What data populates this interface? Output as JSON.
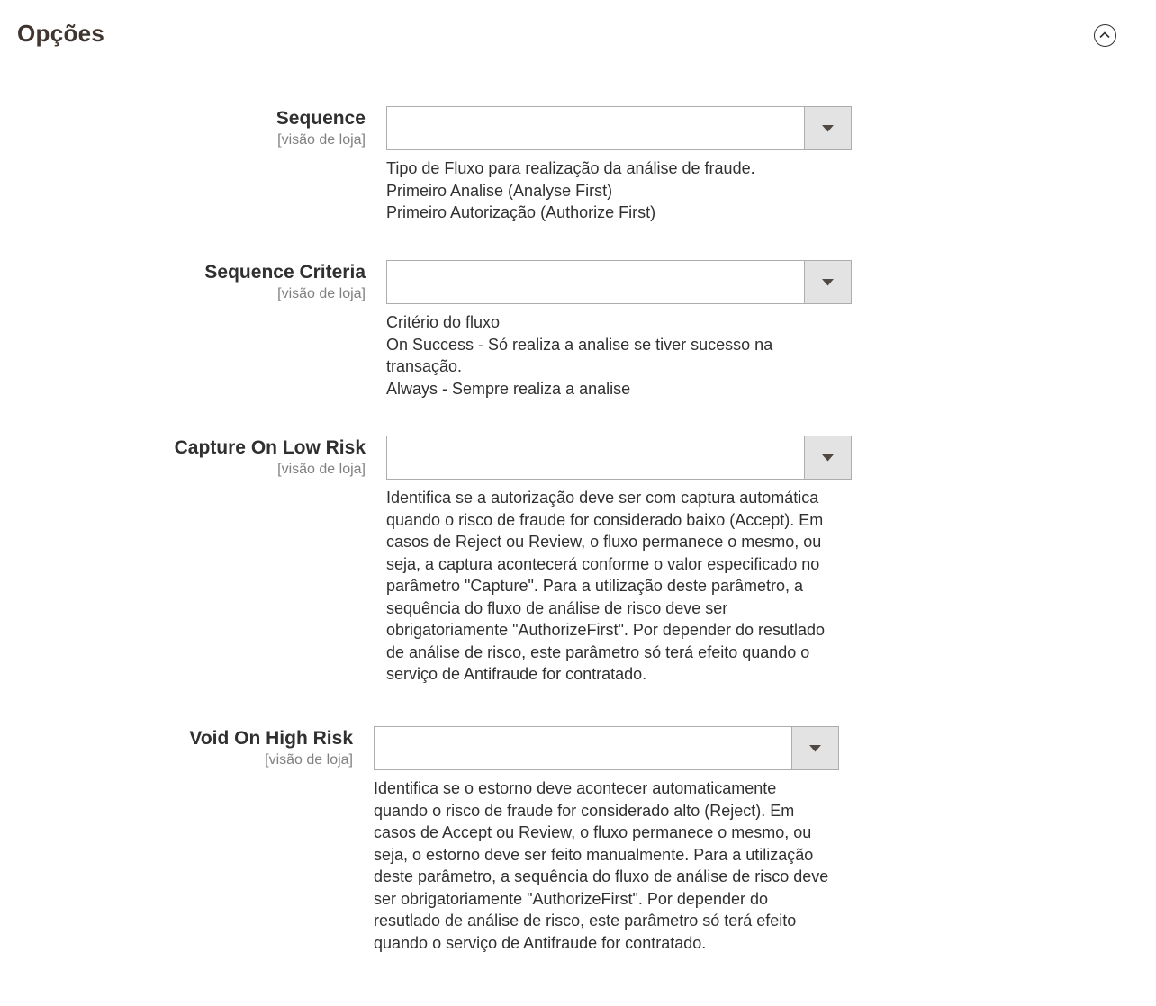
{
  "section": {
    "title": "Opções"
  },
  "fields": [
    {
      "label": "Sequence",
      "scope": "[visão de loja]",
      "value": "",
      "note_lines": [
        "Tipo de Fluxo para realização da análise de fraude.",
        "Primeiro Analise (Analyse First)",
        "Primeiro Autorização (Authorize First)"
      ]
    },
    {
      "label": "Sequence Criteria",
      "scope": "[visão de loja]",
      "value": "",
      "note_lines": [
        "Critério do fluxo",
        "On Success - Só realiza a analise se tiver sucesso na transação.",
        "Always - Sempre realiza a analise"
      ]
    },
    {
      "label": "Capture On Low Risk",
      "scope": "[visão de loja]",
      "value": "",
      "note_lines": [
        "Identifica se a autorização deve ser com captura automática quando o risco de fraude for considerado baixo (Accept). Em casos de Reject ou Review, o fluxo permanece o mesmo, ou seja, a captura acontecerá conforme o valor especificado no parâmetro \"Capture\". Para a utilização deste parâmetro, a sequência do fluxo de análise de risco deve ser obrigatoriamente \"AuthorizeFirst\". Por depender do resutlado de análise de risco, este parâmetro só terá efeito quando o serviço de Antifraude for contratado."
      ]
    },
    {
      "label": "Void On High Risk",
      "scope": "[visão de loja]",
      "value": "",
      "note_lines": [
        "Identifica se o estorno deve acontecer automaticamente quando o risco de fraude for considerado alto (Reject). Em casos de Accept ou Review, o fluxo permanece o mesmo, ou seja, o estorno deve ser feito manualmente. Para a utilização deste parâmetro, a sequência do fluxo de análise de risco deve ser obrigatoriamente \"AuthorizeFirst\". Por depender do resutlado de análise de risco, este parâmetro só terá efeito quando o serviço de Antifraude for contratado."
      ]
    }
  ],
  "icons": {
    "collapse": "chevron-up-circle-icon",
    "select_arrow": "caret-down-icon"
  },
  "colors": {
    "title": "#41362f",
    "text": "#303030",
    "scope": "#808080",
    "select_border": "#adadad",
    "select_arrow_bg": "#e3e3e3"
  }
}
